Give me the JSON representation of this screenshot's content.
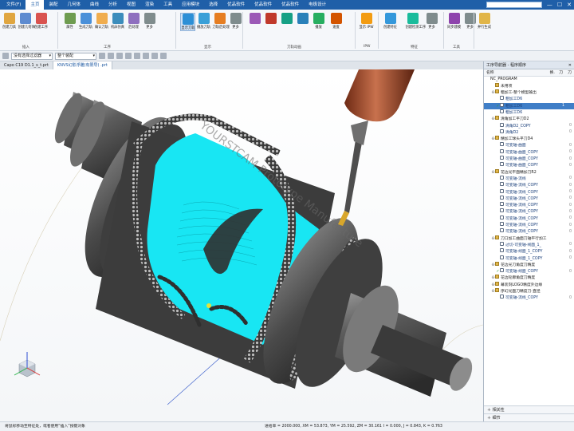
{
  "menu": {
    "items": [
      "文件(F)",
      "主页",
      "装配",
      "几何体",
      "曲线",
      "分析",
      "视图",
      "渲染",
      "工具",
      "应用模块",
      "选择",
      "优品软件",
      "优品软件",
      "优品软件",
      "电极设计"
    ],
    "active_index": 1
  },
  "ribbon": {
    "buttons": [
      "创建刀具",
      "创建几何体",
      "创建工序",
      "属性",
      "生成刀轨",
      "确认刀轨",
      "机床仿真",
      "后处理",
      "更多",
      "显示刀轨",
      "播放刀轨",
      "刀轨后处理",
      "更多",
      "",
      "",
      "",
      "",
      "播放",
      "速度",
      "显示 IPW",
      "创建特征",
      "创建检测工序",
      "更多",
      "同步建模",
      "更多",
      "并行生成"
    ],
    "groups": [
      "插入",
      "工序",
      "显示",
      "刀轨动画",
      "IPW",
      "特征",
      "工具"
    ]
  },
  "toolbar": {
    "filter_label": "菜单(M) ▾",
    "filter_value": "没有选择过滤器",
    "scope_value": "整个装配"
  },
  "tabs": [
    {
      "label": "Capo C19 D1.1_s_t.prt",
      "active": false
    },
    {
      "label": "KNVS幻影浮雕(有限导) .prt",
      "active": true
    }
  ],
  "viewport": {
    "watermark": "YOURSTCAM Prototype Manufacture",
    "colors": {
      "cyan": "#18e6f3",
      "metal": "#4a4a4a",
      "copper": "#a34b2a",
      "bg": "#ffffff"
    }
  },
  "navigator": {
    "title": "工序导航器 - 程序顺序",
    "columns": [
      "名称",
      "换.",
      "刀",
      "刀"
    ],
    "rows": [
      {
        "name": "NC_PROGRAM",
        "indent": 0,
        "type": "text",
        "check": "",
        "c1": "",
        "c2": "",
        "c3": ""
      },
      {
        "name": "未用项",
        "indent": 1,
        "type": "folder",
        "check": "",
        "c1": "",
        "c2": "",
        "c3": ""
      },
      {
        "name": "粗加工-整个模型输出",
        "indent": 1,
        "type": "folder",
        "check": "⊖",
        "c1": "",
        "c2": "",
        "c3": ""
      },
      {
        "name": "粗加工D6",
        "indent": 2,
        "type": "op",
        "check": "",
        "c1": "",
        "c2": "",
        "c3": ""
      },
      {
        "name": "粗加工D6",
        "indent": 2,
        "type": "op",
        "check": "✓",
        "c1": "",
        "c2": "1",
        "c3": "",
        "hl": true
      },
      {
        "name": "粗加工D6",
        "indent": 2,
        "type": "op",
        "check": "",
        "c1": "",
        "c2": "",
        "c3": ""
      },
      {
        "name": "清角加工平刀D2",
        "indent": 1,
        "type": "folder",
        "check": "⊖",
        "c1": "",
        "c2": "",
        "c3": ""
      },
      {
        "name": "清角D2_COPY",
        "indent": 2,
        "type": "op",
        "check": "",
        "c1": "",
        "c2": "",
        "c3": "0"
      },
      {
        "name": "清角D2",
        "indent": 2,
        "type": "op",
        "check": "",
        "c1": "",
        "c2": "",
        "c3": "0"
      },
      {
        "name": "精加工球头平刀D4",
        "indent": 1,
        "type": "folder",
        "check": "⊖",
        "c1": "",
        "c2": "",
        "c3": ""
      },
      {
        "name": "可变轴-曲面",
        "indent": 2,
        "type": "op",
        "check": "",
        "c1": "",
        "c2": "",
        "c3": "0"
      },
      {
        "name": "可变轴-曲面_COPY",
        "indent": 2,
        "type": "op",
        "check": "",
        "c1": "",
        "c2": "",
        "c3": "0"
      },
      {
        "name": "可变轴-曲面_COPY",
        "indent": 2,
        "type": "op",
        "check": "",
        "c1": "",
        "c2": "",
        "c3": "0"
      },
      {
        "name": "可变轴-曲面_COPY",
        "indent": 2,
        "type": "op",
        "check": "",
        "c1": "",
        "c2": "",
        "c3": "0"
      },
      {
        "name": "花边光平面精加刀R2",
        "indent": 1,
        "type": "folder",
        "check": "⊖",
        "c1": "",
        "c2": "",
        "c3": ""
      },
      {
        "name": "可变轴-流线",
        "indent": 2,
        "type": "op",
        "check": "",
        "c1": "",
        "c2": "",
        "c3": "0"
      },
      {
        "name": "可变轴-流线_COPY",
        "indent": 2,
        "type": "op",
        "check": "",
        "c1": "",
        "c2": "",
        "c3": "0"
      },
      {
        "name": "可变轴-流线_COPY",
        "indent": 2,
        "type": "op",
        "check": "",
        "c1": "",
        "c2": "",
        "c3": "0"
      },
      {
        "name": "可变轴-流线_COPY",
        "indent": 2,
        "type": "op",
        "check": "",
        "c1": "",
        "c2": "",
        "c3": "0"
      },
      {
        "name": "可变轴-流线_COPY",
        "indent": 2,
        "type": "op",
        "check": "",
        "c1": "",
        "c2": "",
        "c3": "0"
      },
      {
        "name": "可变轴-流线_COPY",
        "indent": 2,
        "type": "op",
        "check": "",
        "c1": "",
        "c2": "",
        "c3": "0"
      },
      {
        "name": "可变轴-流线_COPY",
        "indent": 2,
        "type": "op",
        "check": "",
        "c1": "",
        "c2": "",
        "c3": "0"
      },
      {
        "name": "可变轴-流线_COPY",
        "indent": 2,
        "type": "op",
        "check": "",
        "c1": "",
        "c2": "",
        "c3": "0"
      },
      {
        "name": "可变轴-流线_COPY",
        "indent": 2,
        "type": "op",
        "check": "",
        "c1": "",
        "c2": "",
        "c3": "0"
      },
      {
        "name": "刀口加工曲面刀轴平行加工",
        "indent": 1,
        "type": "folder",
        "check": "⊖",
        "c1": "",
        "c2": "",
        "c3": ""
      },
      {
        "name": "过切-可变轴-线面_1_",
        "indent": 2,
        "type": "op",
        "check": "",
        "c1": "",
        "c2": "",
        "c3": "0"
      },
      {
        "name": "可变轴-线面_1_COPY",
        "indent": 2,
        "type": "op",
        "check": "",
        "c1": "",
        "c2": "",
        "c3": "0"
      },
      {
        "name": "可变轴-线面_1_COPY",
        "indent": 2,
        "type": "op",
        "check": "",
        "c1": "",
        "c2": "",
        "c3": "0"
      },
      {
        "name": "花边光刀角度刀精度",
        "indent": 1,
        "type": "folder",
        "check": "⊖",
        "c1": "",
        "c2": "",
        "c3": ""
      },
      {
        "name": "可变轴-线面_COPY",
        "indent": 2,
        "type": "op",
        "check": "✓",
        "c1": "",
        "c2": "",
        "c3": "0"
      },
      {
        "name": "花边轮廓角度刀精度",
        "indent": 1,
        "type": "folder",
        "check": "⊖",
        "c1": "",
        "c2": "",
        "c3": ""
      },
      {
        "name": "幕装刻LOGO精度外边缘",
        "indent": 1,
        "type": "folder",
        "check": "⊖",
        "c1": "",
        "c2": "",
        "c3": ""
      },
      {
        "name": "序幻光面刀精度刀-直径",
        "indent": 1,
        "type": "folder",
        "check": "⊖",
        "c1": "",
        "c2": "",
        "c3": ""
      },
      {
        "name": "可变轴-流线_COPY",
        "indent": 2,
        "type": "op",
        "check": "",
        "c1": "",
        "c2": "",
        "c3": "0"
      }
    ],
    "footer": [
      "相关性",
      "细节"
    ]
  },
  "status": {
    "left": "将鼠标移动至特征处，或者使用“插入”按键对象",
    "right": "进给率 = 2000.000, XM = 53.873, YM = 25.592, ZM = 30.161 I = 0.000, J = 0.843, K = 0.763"
  }
}
